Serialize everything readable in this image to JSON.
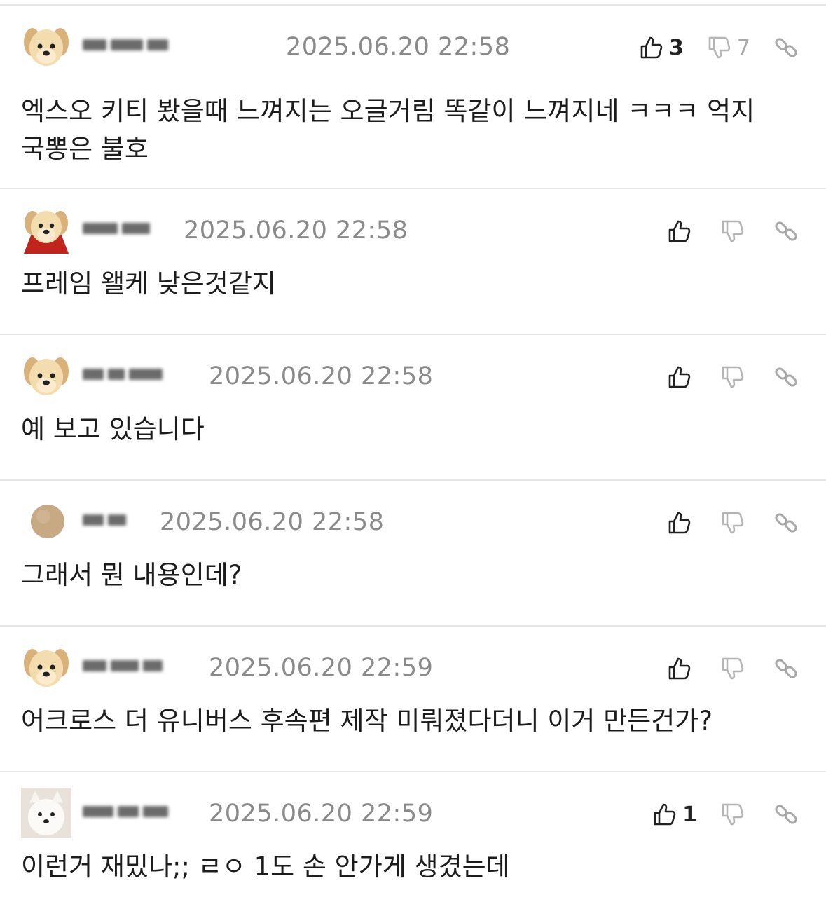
{
  "comments": [
    {
      "nickname": "닉네임",
      "date": "2025.06.20 22:58",
      "likes": "3",
      "dislikes": "7",
      "text": "엑스오 키티 봤을때 느껴지는 오글거림 똑같이 느껴지네 ㅋㅋㅋ 억지 국뽕은 불호",
      "avatar": "puppy-icon"
    },
    {
      "nickname": "닉네임",
      "date": "2025.06.20 22:58",
      "likes": "",
      "dislikes": "",
      "text": "프레임 왤케 낮은것같지",
      "avatar": "puppy-cape-icon"
    },
    {
      "nickname": "닉네임",
      "date": "2025.06.20 22:58",
      "likes": "",
      "dislikes": "",
      "text": "예 보고 있습니다",
      "avatar": "puppy-icon"
    },
    {
      "nickname": "닉네임",
      "date": "2025.06.20 22:58",
      "likes": "",
      "dislikes": "",
      "text": "그래서 뭔 내용인데?",
      "avatar": "circle-avatar-icon"
    },
    {
      "nickname": "닉네임",
      "date": "2025.06.20 22:59",
      "likes": "",
      "dislikes": "",
      "text": "어크로스 더 유니버스 후속편 제작 미뤄졌다더니 이거 만든건가?",
      "avatar": "puppy-icon"
    },
    {
      "nickname": "닉네임",
      "date": "2025.06.20 22:59",
      "likes": "1",
      "dislikes": "",
      "text": "이런거 재밌나;; ㄹㅇ 1도 손 안가게 생겼는데",
      "avatar": "white-dog-icon"
    }
  ],
  "icons": {
    "like": "thumbs-up-icon",
    "dislike": "thumbs-down-icon",
    "link": "link-icon"
  },
  "colors": {
    "text": "#1c1c1c",
    "meta": "#8a8a8a",
    "divider": "#e6e6e6",
    "puppy": "#f0d6a8"
  }
}
